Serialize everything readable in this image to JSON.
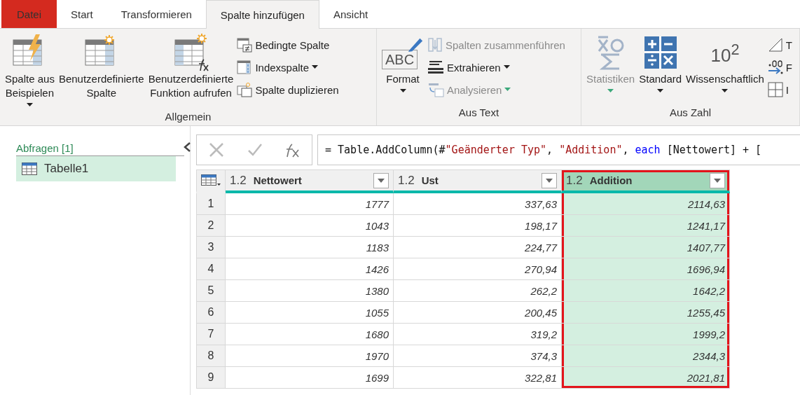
{
  "tabs": [
    {
      "label": "Datei",
      "kind": "file",
      "selected": false
    },
    {
      "label": "Start",
      "kind": "normal",
      "selected": false
    },
    {
      "label": "Transformieren",
      "kind": "normal",
      "selected": false
    },
    {
      "label": "Spalte hinzufügen",
      "kind": "normal",
      "selected": true
    },
    {
      "label": "Ansicht",
      "kind": "normal",
      "selected": false
    }
  ],
  "ribbon": {
    "groups": [
      {
        "label": "Allgemein",
        "large_buttons": [
          {
            "kind": "examples",
            "lines": [
              "Spalte aus",
              "Beispielen"
            ],
            "dropdown": true,
            "disabled": false
          },
          {
            "kind": "custom",
            "lines": [
              "Benutzerdefinierte",
              "Spalte"
            ],
            "dropdown": false,
            "disabled": false
          },
          {
            "kind": "function",
            "lines": [
              "Benutzerdefinierte",
              "Funktion aufrufen"
            ],
            "dropdown": false,
            "disabled": false
          }
        ],
        "small_buttons": [
          {
            "kind": "conditional",
            "label": "Bedingte Spalte",
            "dropdown": false,
            "disabled": false
          },
          {
            "kind": "index",
            "label": "Indexspalte",
            "dropdown": true,
            "disabled": false
          },
          {
            "kind": "duplicate",
            "label": "Spalte duplizieren",
            "dropdown": false,
            "disabled": false
          }
        ]
      },
      {
        "label": "Aus Text",
        "large_buttons": [
          {
            "kind": "format",
            "glyph": "ABC",
            "lines": [
              "Format"
            ],
            "dropdown": true,
            "disabled": false
          }
        ],
        "small_buttons": [
          {
            "kind": "merge",
            "label": "Spalten zusammenführen",
            "dropdown": false,
            "disabled": true
          },
          {
            "kind": "extract",
            "label": "Extrahieren",
            "dropdown": true,
            "disabled": false
          },
          {
            "kind": "parse",
            "label": "Analysieren",
            "dropdown": true,
            "disabled": true
          }
        ]
      },
      {
        "label": "Aus Zahl",
        "large_buttons": [
          {
            "kind": "statistics",
            "lines": [
              "Statistiken"
            ],
            "dropdown": true,
            "disabled": true
          },
          {
            "kind": "standard",
            "lines": [
              "Standard"
            ],
            "dropdown": true,
            "disabled": false
          },
          {
            "kind": "scientific",
            "glyph": "10$^{2}$",
            "lines": [
              "Wissenschaftlich"
            ],
            "dropdown": true,
            "disabled": false
          }
        ],
        "small_buttons": [
          {
            "kind": "trig",
            "label": "T",
            "dropdown": false,
            "disabled": false
          },
          {
            "kind": "rounding",
            "label": "F",
            "dropdown": false,
            "disabled": false
          },
          {
            "kind": "info",
            "label": "I",
            "dropdown": false,
            "disabled": false
          }
        ]
      }
    ]
  },
  "queries": {
    "title": "Abfragen [1]",
    "items": [
      {
        "label": "Tabelle1",
        "selected": true
      }
    ]
  },
  "formula": {
    "tokens": [
      {
        "kind": "plain",
        "text": "= Table.AddColumn(#"
      },
      {
        "kind": "string",
        "text": "\"Geänderter Typ\""
      },
      {
        "kind": "plain",
        "text": ", "
      },
      {
        "kind": "string",
        "text": "\"Addition\""
      },
      {
        "kind": "plain",
        "text": ", "
      },
      {
        "kind": "keyword",
        "text": "each"
      },
      {
        "kind": "plain",
        "text": " [Nettowert] + ["
      }
    ]
  },
  "table": {
    "columns": [
      {
        "type": "1.2",
        "name": "Nettowert",
        "selected": false
      },
      {
        "type": "1.2",
        "name": "Ust",
        "selected": false
      },
      {
        "type": "1.2",
        "name": "Addition",
        "selected": true
      }
    ],
    "rows": [
      {
        "number": "1",
        "cells": [
          "1777",
          "337,63",
          "2114,63"
        ]
      },
      {
        "number": "2",
        "cells": [
          "1043",
          "198,17",
          "1241,17"
        ]
      },
      {
        "number": "3",
        "cells": [
          "1183",
          "224,77",
          "1407,77"
        ]
      },
      {
        "number": "4",
        "cells": [
          "1426",
          "270,94",
          "1696,94"
        ]
      },
      {
        "number": "5",
        "cells": [
          "1380",
          "262,2",
          "1642,2"
        ]
      },
      {
        "number": "6",
        "cells": [
          "1055",
          "200,45",
          "1255,45"
        ]
      },
      {
        "number": "7",
        "cells": [
          "1680",
          "319,2",
          "1999,2"
        ]
      },
      {
        "number": "8",
        "cells": [
          "1970",
          "374,3",
          "2344,3"
        ]
      },
      {
        "number": "9",
        "cells": [
          "1699",
          "322,81",
          "2021,81"
        ]
      }
    ]
  }
}
